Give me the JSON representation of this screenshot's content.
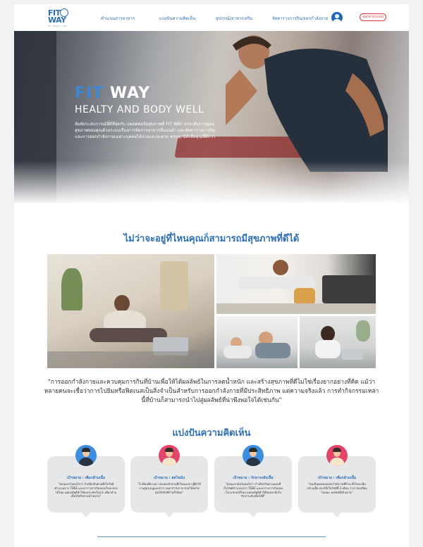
{
  "header": {
    "logo_text": "FIT WAY",
    "logo_sub": "FIT • HEALTHY • WELL",
    "nav": [
      {
        "label": "คำนวณสารอาหาร"
      },
      {
        "label": "แบ่งปันความคิดเห็น"
      },
      {
        "label": "อุปกรณ์/อาหารเสริม"
      },
      {
        "label": "จัดตารางการกิน/ออกกำลังกาย"
      }
    ],
    "user_icon": "user-icon",
    "logout_label": "ออกจากระบบ"
  },
  "hero": {
    "title_fit": "FIT",
    "title_way": "WAY",
    "subtitle": "HEALTY AND BODY WELL",
    "description": "ลัมพ์ประสบการณ์ที่ดีที่สุดกับ แพลตฟอร์มสุขภาพที่ FIT WAY ยกระดับการดูแลสุขภาพของคุณด้วยระบบเรื่องการจัดการอาหารที่แม่นยำ และจัดตารางการกิน และการออกกำลังกายเฉพาะบุคคลได้ง่ายและสะดวก ครบทุกมิติเพื่อคุณที่ดีกว่า"
  },
  "section1": {
    "title": "ไม่ว่าจะอยู่ที่ไหนคุณก็สามารถมีสุขภาพที่ดีได้",
    "quote": "\"การออกกำลังกายและควบคุมการกินที่บ้านเพื่อให้ได้ผลลัพธ์ในการลดน้ำหนัก และสร้างสุขภาพที่ดีไม่ใช่เรื่องยากอย่างที่คิด แม้ว่าหลายคนจะเชื่อว่าการไปยิมหรือฟิตเนสเป็นสิ่งจำเป็นสำหรับการออกกำลังกายที่มีประสิทธิภาพ แต่ความจริงแล้ว การทำกิจกรรมเหล่านี้ที่บ้านก็สามารถนำไปสู่ผลลัพธ์ที่น่าพึงพอใจได้เช่นกัน\""
  },
  "section2": {
    "title": "แบ่งปันความคิดเห็น",
    "reviews": [
      {
        "name": "เป้าหมาย : เพิ่มกล้ามเนื้อ",
        "text": "\"ตอนแรกไม่แน่ใจว่า ถ้าเลือกกินตามที่เว็บไซต์คำนวณจาก TDEE และตารางการกินของเว็บจะช่วยได้ไหม แต่ผลลัพธ์ทำให้ผมประทับใจมาก เพิ่มกล้ามเนื้อได้จริงตามเป้าหมาย\""
      },
      {
        "name": "เป้าหมาย : ลดไขมัน",
        "text": "\"3 เดือนที่ผ่านมา ฉันลองทำตามที่เว็บแนะนำ ผู้ฝึกใช้งานสูตรเมนูและตารางออกกำลังกาย ช่วยให้ลดไขมันได้จริงที่บ้านก็ได้ผล\""
      },
      {
        "name": "เป้าหมาย : รักษาระดับเนื้อ",
        "text": "\"ตอนแรกฉันไม่แน่ใจว่า ถ้าเลือกกินตามแผนที่เว็บไซต์คำนวณจาก TDEE และตารางการกินของเว็บจะช่วยได้ไหม แต่ผลลัพธ์ทำให้ฉันประทับใจ รักษาระดับเนื้อได้ดี\""
      },
      {
        "name": "เป้าหมาย : เพิ่มกล้ามเนื้อ",
        "text": "\"ฉันเป็นคนชอบออกกำลังกายที่บ้าน ตั้งใจจะเพิ่มกล้ามเนื้อ ลองใช้เว็บไซต์นี้ 3 เดือน ร่างกายเปลี่ยนไปเยอะ ผลลัพธ์ดีเกินคาด\""
      }
    ]
  },
  "colors": {
    "brand_blue": "#2c6fb5",
    "logout_red": "#e0343c",
    "card_bg": "#e6e7e9"
  }
}
